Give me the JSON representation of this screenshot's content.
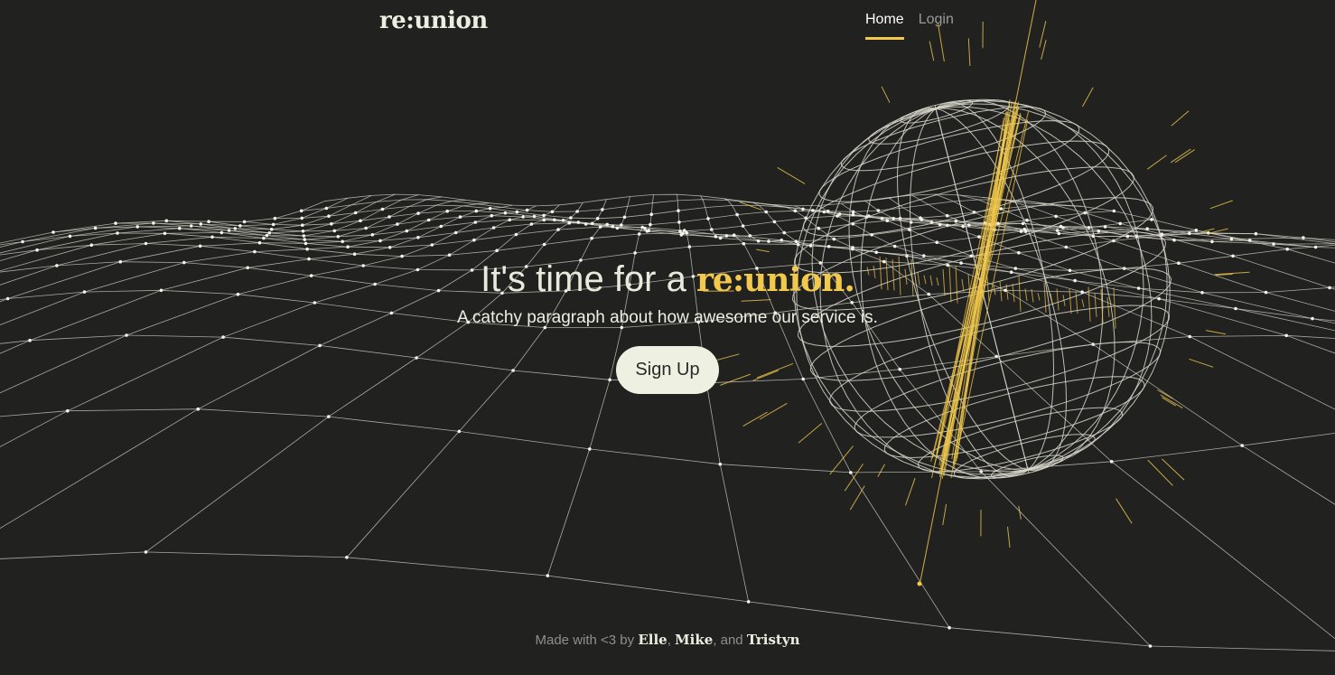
{
  "nav": {
    "brand": "re:union",
    "links": [
      {
        "label": "Home",
        "active": true
      },
      {
        "label": "Login",
        "active": false
      }
    ]
  },
  "hero": {
    "title_prefix": "It's time for a ",
    "title_accent": "re:union.",
    "subtitle": "A catchy paragraph about how awesome our service is.",
    "cta_label": "Sign Up"
  },
  "footer": {
    "prefix": "Made with <3 by ",
    "names": [
      "Elle",
      "Mike",
      "Tristyn"
    ],
    "sep1": ", ",
    "sep2": ", and "
  },
  "colors": {
    "background": "#212120",
    "accent": "#f2c94c",
    "text": "#e9ebde",
    "wire": "#d8d8cc"
  }
}
